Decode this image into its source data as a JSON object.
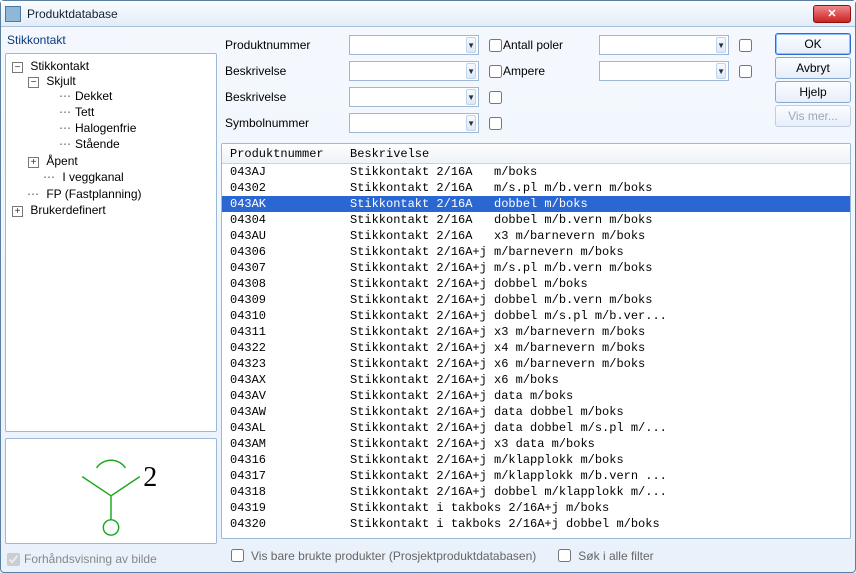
{
  "window": {
    "title": "Produktdatabase"
  },
  "left_label": "Stikkontakt",
  "tree": {
    "root": {
      "label": "Stikkontakt",
      "children_labels": {
        "skjult": "Skjult",
        "dekket": "Dekket",
        "tett": "Tett",
        "halogenfrie": "Halogenfrie",
        "staende": "Stående",
        "apent": "Åpent",
        "iveggkanal": "I veggkanal"
      }
    },
    "fp": "FP (Fastplanning)",
    "brukerdef": "Brukerdefinert"
  },
  "preview": {
    "value": "2"
  },
  "preview_check": {
    "label": "Forhåndsvisning av bilde",
    "checked": true
  },
  "filters": {
    "produktnummer": "Produktnummer",
    "antall_poler": "Antall poler",
    "beskrivelse": "Beskrivelse",
    "ampere": "Ampere",
    "beskrivelse2": "Beskrivelse",
    "symbolnummer": "Symbolnummer"
  },
  "buttons": {
    "ok": "OK",
    "avbryt": "Avbryt",
    "hjelp": "Hjelp",
    "vismer": "Vis mer..."
  },
  "grid": {
    "headers": {
      "produktnummer": "Produktnummer",
      "beskrivelse": "Beskrivelse"
    },
    "rows": [
      {
        "pn": "043AJ",
        "bs": "Stikkontakt 2/16A   m/boks"
      },
      {
        "pn": "04302",
        "bs": "Stikkontakt 2/16A   m/s.pl m/b.vern m/boks"
      },
      {
        "pn": "043AK",
        "bs": "Stikkontakt 2/16A   dobbel m/boks",
        "sel": true
      },
      {
        "pn": "04304",
        "bs": "Stikkontakt 2/16A   dobbel m/b.vern m/boks"
      },
      {
        "pn": "043AU",
        "bs": "Stikkontakt 2/16A   x3 m/barnevern m/boks"
      },
      {
        "pn": "04306",
        "bs": "Stikkontakt 2/16A+j m/barnevern m/boks"
      },
      {
        "pn": "04307",
        "bs": "Stikkontakt 2/16A+j m/s.pl m/b.vern m/boks"
      },
      {
        "pn": "04308",
        "bs": "Stikkontakt 2/16A+j dobbel m/boks"
      },
      {
        "pn": "04309",
        "bs": "Stikkontakt 2/16A+j dobbel m/b.vern m/boks"
      },
      {
        "pn": "04310",
        "bs": "Stikkontakt 2/16A+j dobbel m/s.pl m/b.ver..."
      },
      {
        "pn": "04311",
        "bs": "Stikkontakt 2/16A+j x3 m/barnevern m/boks"
      },
      {
        "pn": "04322",
        "bs": "Stikkontakt 2/16A+j x4 m/barnevern m/boks"
      },
      {
        "pn": "04323",
        "bs": "Stikkontakt 2/16A+j x6 m/barnevern m/boks"
      },
      {
        "pn": "043AX",
        "bs": "Stikkontakt 2/16A+j x6 m/boks"
      },
      {
        "pn": "043AV",
        "bs": "Stikkontakt 2/16A+j data m/boks"
      },
      {
        "pn": "043AW",
        "bs": "Stikkontakt 2/16A+j data dobbel m/boks"
      },
      {
        "pn": "043AL",
        "bs": "Stikkontakt 2/16A+j data dobbel m/s.pl m/..."
      },
      {
        "pn": "043AM",
        "bs": "Stikkontakt 2/16A+j x3 data m/boks"
      },
      {
        "pn": "04316",
        "bs": "Stikkontakt 2/16A+j m/klapplokk m/boks"
      },
      {
        "pn": "04317",
        "bs": "Stikkontakt 2/16A+j m/klapplokk m/b.vern ..."
      },
      {
        "pn": "04318",
        "bs": "Stikkontakt 2/16A+j dobbel m/klapplokk m/..."
      },
      {
        "pn": "04319",
        "bs": "Stikkontakt i takboks 2/16A+j m/boks"
      },
      {
        "pn": "04320",
        "bs": "Stikkontakt i takboks 2/16A+j dobbel m/boks"
      }
    ]
  },
  "footer": {
    "vis_bare": "Vis bare brukte produkter (Prosjektproduktdatabasen)",
    "sok_alle": "Søk i alle filter"
  }
}
